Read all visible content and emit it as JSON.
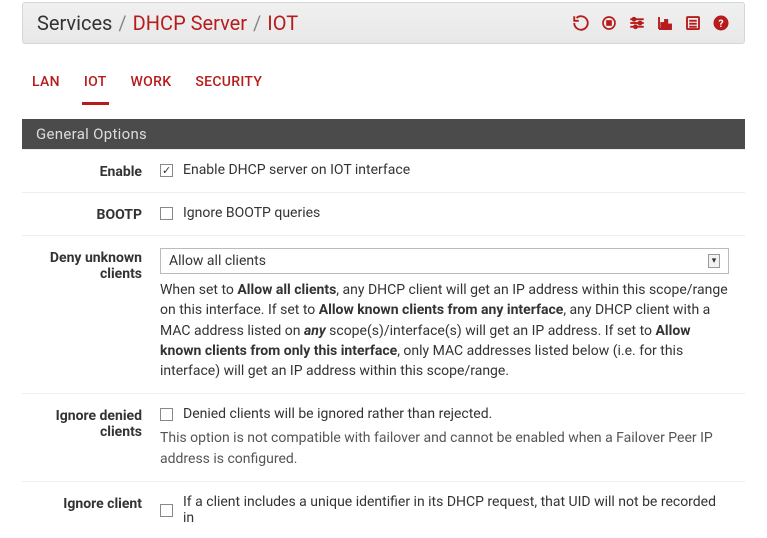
{
  "breadcrumb": {
    "seg1": "Services",
    "seg2": "DHCP Server",
    "seg3": "IOT"
  },
  "tabs": {
    "lan": "LAN",
    "iot": "IOT",
    "work": "WORK",
    "security": "SECURITY"
  },
  "panel": {
    "title": "General Options"
  },
  "enable": {
    "label": "Enable",
    "text": "Enable DHCP server on IOT interface"
  },
  "bootp": {
    "label": "BOOTP",
    "text": "Ignore BOOTP queries"
  },
  "deny": {
    "label": "Deny unknown clients",
    "select_value": "Allow all clients",
    "help_pre1": "When set to ",
    "help_b1": "Allow all clients",
    "help_post1": ", any DHCP client will get an IP address within this scope/range on this interface. If set to ",
    "help_b2": "Allow known clients from any interface",
    "help_post2": ", any DHCP client with a MAC address listed on ",
    "help_em": "any",
    "help_post3": " scope(s)/interface(s) will get an IP address. If set to ",
    "help_b3": "Allow known clients from only this interface",
    "help_post4": ", only MAC addresses listed below (i.e. for this interface) will get an IP address within this scope/range."
  },
  "ignore_denied": {
    "label": "Ignore denied clients",
    "text": "Denied clients will be ignored rather than rejected.",
    "note": "This option is not compatible with failover and cannot be enabled when a Failover Peer IP address is configured."
  },
  "ignore_client": {
    "label": "Ignore client",
    "text": "If a client includes a unique identifier in its DHCP request, that UID will not be recorded in"
  }
}
